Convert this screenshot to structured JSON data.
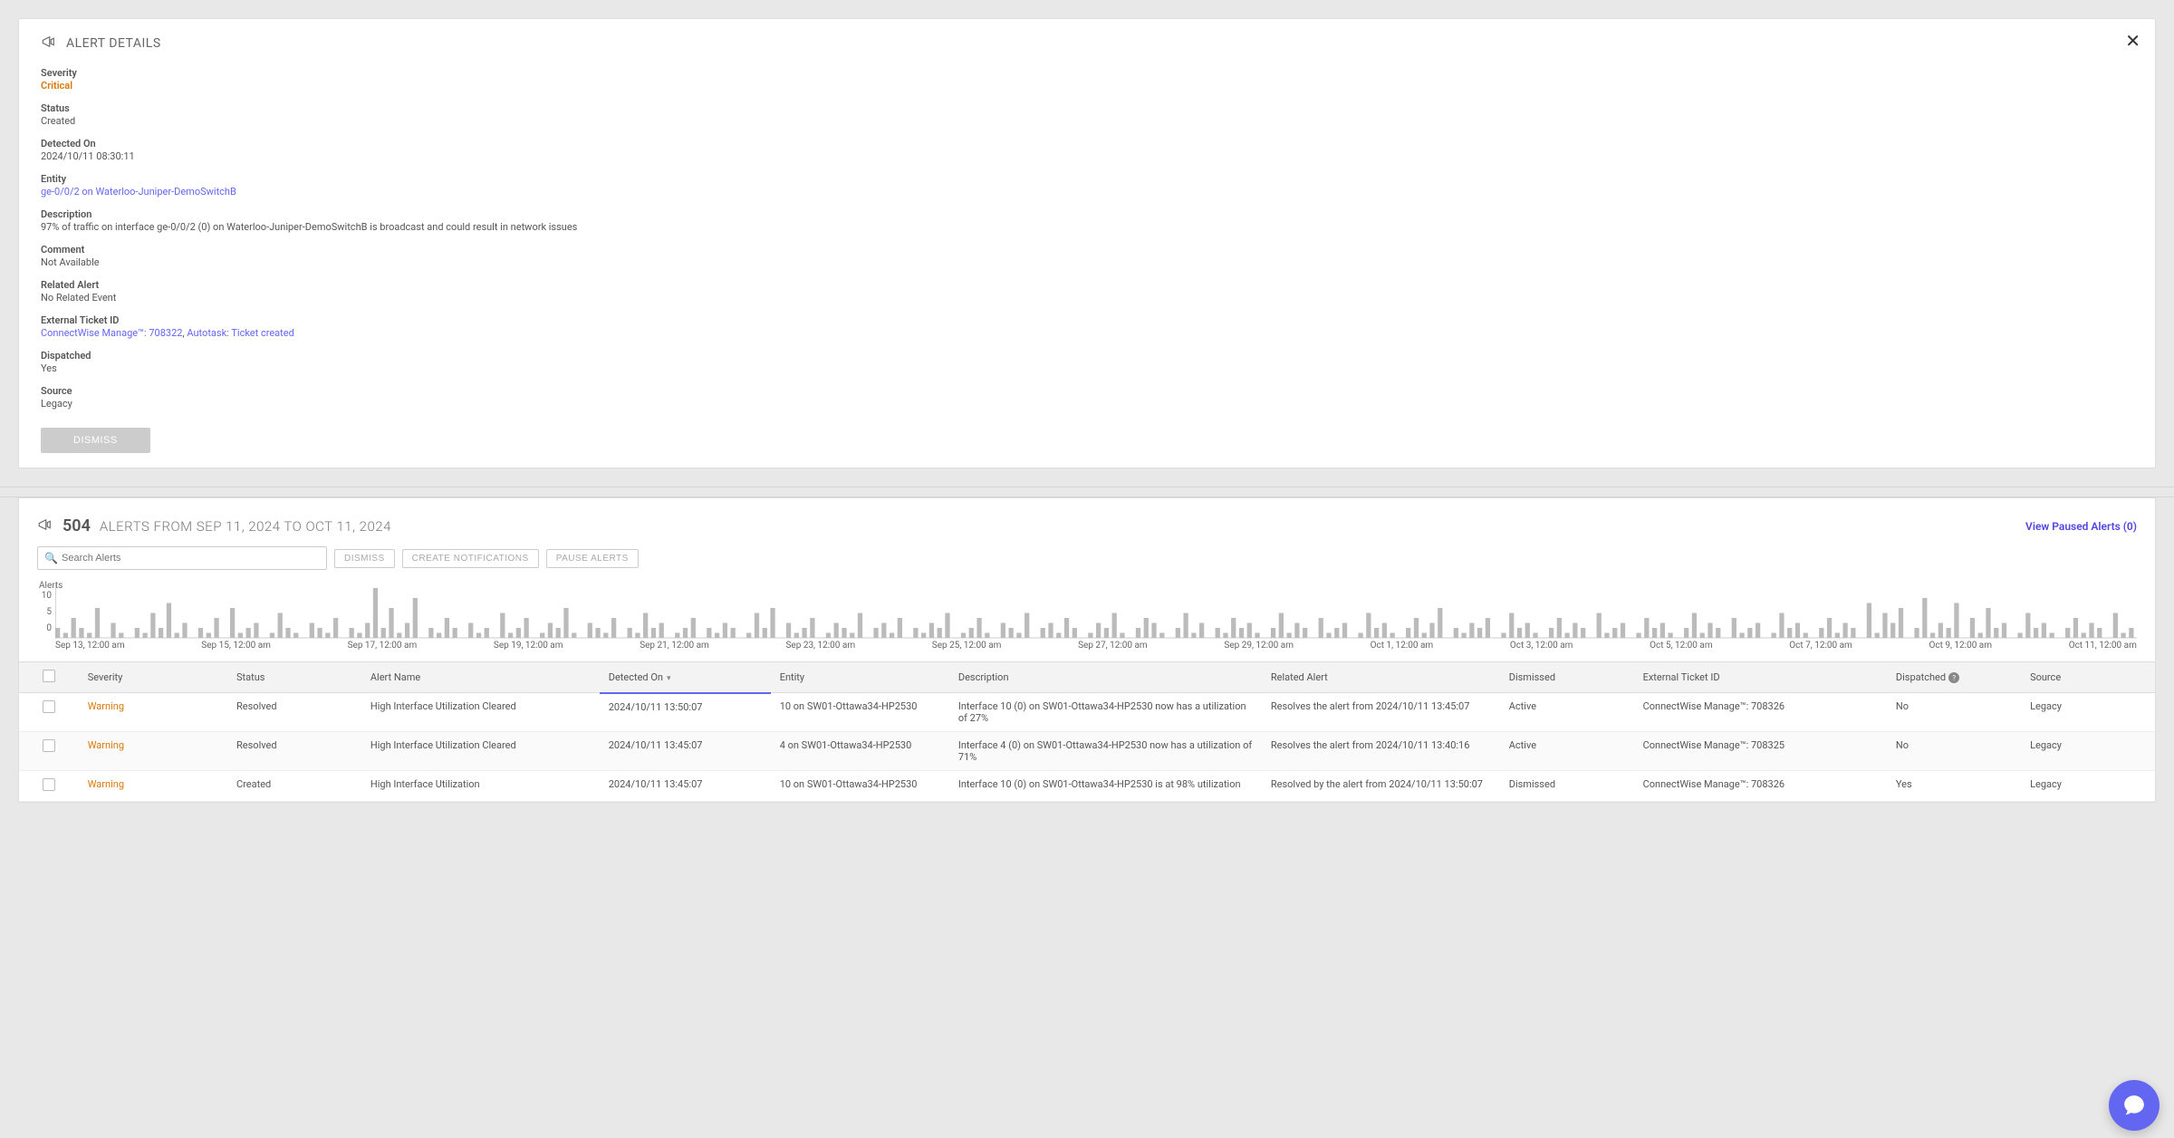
{
  "alert_details": {
    "title": "ALERT DETAILS",
    "fields": {
      "severity_label": "Severity",
      "severity_value": "Critical",
      "status_label": "Status",
      "status_value": "Created",
      "detected_label": "Detected On",
      "detected_value": "2024/10/11 08:30:11",
      "entity_label": "Entity",
      "entity_value": "ge-0/0/2 on Waterloo-Juniper-DemoSwitchB",
      "description_label": "Description",
      "description_value": "97% of traffic on interface ge-0/0/2 (0) on Waterloo-Juniper-DemoSwitchB is broadcast and could result in network issues",
      "comment_label": "Comment",
      "comment_value": "Not Available",
      "related_label": "Related Alert",
      "related_value": "No Related Event",
      "ticket_label": "External Ticket ID",
      "ticket_value_1": "ConnectWise Manage™: 708322",
      "ticket_sep": ", ",
      "ticket_value_2": "Autotask: Ticket created",
      "dispatched_label": "Dispatched",
      "dispatched_value": "Yes",
      "source_label": "Source",
      "source_value": "Legacy"
    },
    "dismiss_label": "DISMISS"
  },
  "alerts_panel": {
    "count": "504",
    "title": "ALERTS FROM SEP 11, 2024 TO OCT 11, 2024",
    "paused_link": "View Paused Alerts (0)",
    "search_placeholder": "Search Alerts",
    "btn_dismiss": "DISMISS",
    "btn_create": "CREATE NOTIFICATIONS",
    "btn_pause": "PAUSE ALERTS"
  },
  "chart_data": {
    "type": "bar",
    "ylabel": "Alerts",
    "ylim": [
      0,
      10
    ],
    "yticks": [
      10,
      5,
      0
    ],
    "categories": [
      "Sep 13, 12:00 am",
      "Sep 15, 12:00 am",
      "Sep 17, 12:00 am",
      "Sep 19, 12:00 am",
      "Sep 21, 12:00 am",
      "Sep 23, 12:00 am",
      "Sep 25, 12:00 am",
      "Sep 27, 12:00 am",
      "Sep 29, 12:00 am",
      "Oct 1, 12:00 am",
      "Oct 3, 12:00 am",
      "Oct 5, 12:00 am",
      "Oct 7, 12:00 am",
      "Oct 9, 12:00 am",
      "Oct 11, 12:00 am"
    ],
    "values": [
      2,
      1,
      4,
      2,
      1,
      6,
      0,
      3,
      1,
      0,
      2,
      1,
      5,
      2,
      7,
      1,
      3,
      0,
      2,
      1,
      4,
      0,
      6,
      1,
      2,
      3,
      0,
      1,
      5,
      2,
      1,
      0,
      3,
      2,
      1,
      4,
      0,
      2,
      1,
      3,
      10,
      2,
      6,
      1,
      3,
      8,
      0,
      2,
      1,
      4,
      2,
      0,
      3,
      1,
      2,
      0,
      5,
      1,
      2,
      4,
      0,
      1,
      3,
      2,
      6,
      1,
      0,
      3,
      2,
      1,
      4,
      0,
      2,
      1,
      5,
      2,
      3,
      0,
      1,
      2,
      4,
      0,
      2,
      1,
      3,
      2,
      0,
      1,
      5,
      2,
      6,
      0,
      3,
      1,
      2,
      4,
      0,
      1,
      3,
      2,
      1,
      5,
      0,
      2,
      3,
      1,
      4,
      0,
      2,
      1,
      3,
      2,
      5,
      0,
      1,
      2,
      4,
      1,
      0,
      3,
      2,
      1,
      5,
      0,
      2,
      3,
      1,
      4,
      2,
      0,
      1,
      3,
      2,
      5,
      1,
      0,
      2,
      4,
      3,
      1,
      0,
      2,
      5,
      1,
      3,
      0,
      2,
      1,
      4,
      2,
      3,
      1,
      0,
      2,
      5,
      1,
      3,
      2,
      0,
      4,
      1,
      2,
      3,
      0,
      1,
      5,
      2,
      3,
      1,
      0,
      2,
      4,
      1,
      3,
      6,
      0,
      2,
      1,
      3,
      2,
      4,
      0,
      1,
      5,
      2,
      3,
      1,
      0,
      2,
      4,
      1,
      3,
      2,
      0,
      5,
      1,
      2,
      3,
      0,
      1,
      4,
      2,
      3,
      1,
      0,
      2,
      5,
      1,
      3,
      2,
      0,
      4,
      1,
      2,
      3,
      0,
      1,
      5,
      2,
      3,
      1,
      0,
      2,
      4,
      1,
      3,
      2,
      0,
      7,
      1,
      5,
      3,
      6,
      0,
      2,
      8,
      1,
      3,
      2,
      7,
      0,
      4,
      1,
      6,
      2,
      3,
      0,
      1,
      5,
      2,
      3,
      1,
      0,
      2,
      4,
      1,
      3,
      2,
      0,
      5,
      1,
      2
    ]
  },
  "table": {
    "columns": {
      "severity": "Severity",
      "status": "Status",
      "alert_name": "Alert Name",
      "detected_on": "Detected On",
      "entity": "Entity",
      "description": "Description",
      "related_alert": "Related Alert",
      "dismissed": "Dismissed",
      "external_ticket": "External Ticket ID",
      "dispatched": "Dispatched",
      "source": "Source"
    },
    "rows": [
      {
        "severity": "Warning",
        "status": "Resolved",
        "alert_name": "High Interface Utilization Cleared",
        "detected_on": "2024/10/11 13:50:07",
        "entity": "10 on SW01-Ottawa34-HP2530",
        "description": "Interface 10 (0) on SW01-Ottawa34-HP2530 now has a utilization of 27%",
        "related_alert": "Resolves the alert from 2024/10/11 13:45:07",
        "dismissed": "Active",
        "external_ticket": "ConnectWise Manage™: 708326",
        "dispatched": "No",
        "source": "Legacy"
      },
      {
        "severity": "Warning",
        "status": "Resolved",
        "alert_name": "High Interface Utilization Cleared",
        "detected_on": "2024/10/11 13:45:07",
        "entity": "4 on SW01-Ottawa34-HP2530",
        "description": "Interface 4 (0) on SW01-Ottawa34-HP2530 now has a utilization of 71%",
        "related_alert": "Resolves the alert from 2024/10/11 13:40:16",
        "dismissed": "Active",
        "external_ticket": "ConnectWise Manage™: 708325",
        "dispatched": "No",
        "source": "Legacy"
      },
      {
        "severity": "Warning",
        "status": "Created",
        "alert_name": "High Interface Utilization",
        "detected_on": "2024/10/11 13:45:07",
        "entity": "10 on SW01-Ottawa34-HP2530",
        "description": "Interface 10 (0) on SW01-Ottawa34-HP2530 is at 98% utilization",
        "related_alert": "Resolved by the alert from 2024/10/11 13:50:07",
        "dismissed": "Dismissed",
        "external_ticket": "ConnectWise Manage™: 708326",
        "dispatched": "Yes",
        "source": "Legacy"
      }
    ]
  }
}
